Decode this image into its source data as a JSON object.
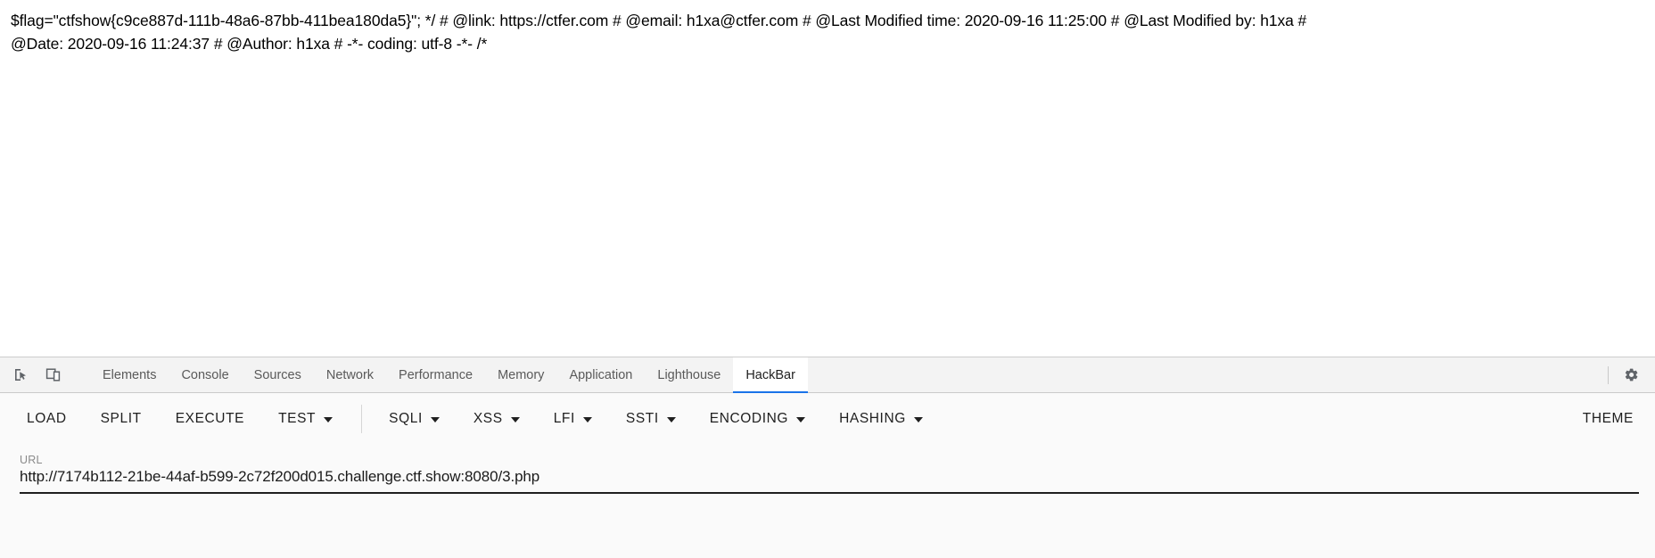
{
  "page": {
    "content_line1": "$flag=\"ctfshow{c9ce887d-111b-48a6-87bb-411bea180da5}\"; */ # @link: https://ctfer.com # @email: h1xa@ctfer.com # @Last Modified time: 2020-09-16 11:25:00 # @Last Modified by: h1xa #",
    "content_line2": "@Date: 2020-09-16 11:24:37 # @Author: h1xa # -*- coding: utf-8 -*- /*",
    "flag": "ctfshow{c9ce887d-111b-48a6-87bb-411bea180da5}"
  },
  "devtools": {
    "inspect_icon": "inspect-element-icon",
    "device_icon": "device-toolbar-icon",
    "settings_icon": "gear-icon",
    "tabs": [
      {
        "label": "Elements",
        "active": false
      },
      {
        "label": "Console",
        "active": false
      },
      {
        "label": "Sources",
        "active": false
      },
      {
        "label": "Network",
        "active": false
      },
      {
        "label": "Performance",
        "active": false
      },
      {
        "label": "Memory",
        "active": false
      },
      {
        "label": "Application",
        "active": false
      },
      {
        "label": "Lighthouse",
        "active": false
      },
      {
        "label": "HackBar",
        "active": true
      }
    ],
    "active_tab": "HackBar",
    "accent_color": "#1a73e8"
  },
  "hackbar": {
    "buttons": [
      {
        "label": "LOAD",
        "dropdown": false
      },
      {
        "label": "SPLIT",
        "dropdown": false
      },
      {
        "label": "EXECUTE",
        "dropdown": false
      },
      {
        "label": "TEST",
        "dropdown": true
      },
      {
        "label": "SQLI",
        "dropdown": true
      },
      {
        "label": "XSS",
        "dropdown": true
      },
      {
        "label": "LFI",
        "dropdown": true
      },
      {
        "label": "SSTI",
        "dropdown": true
      },
      {
        "label": "ENCODING",
        "dropdown": true
      },
      {
        "label": "HASHING",
        "dropdown": true
      }
    ],
    "separator_after_index": 3,
    "theme_label": "THEME",
    "url_field": {
      "label": "URL",
      "value": "http://7174b112-21be-44af-b599-2c72f200d015.challenge.ctf.show:8080/3.php",
      "placeholder": "URL"
    }
  }
}
